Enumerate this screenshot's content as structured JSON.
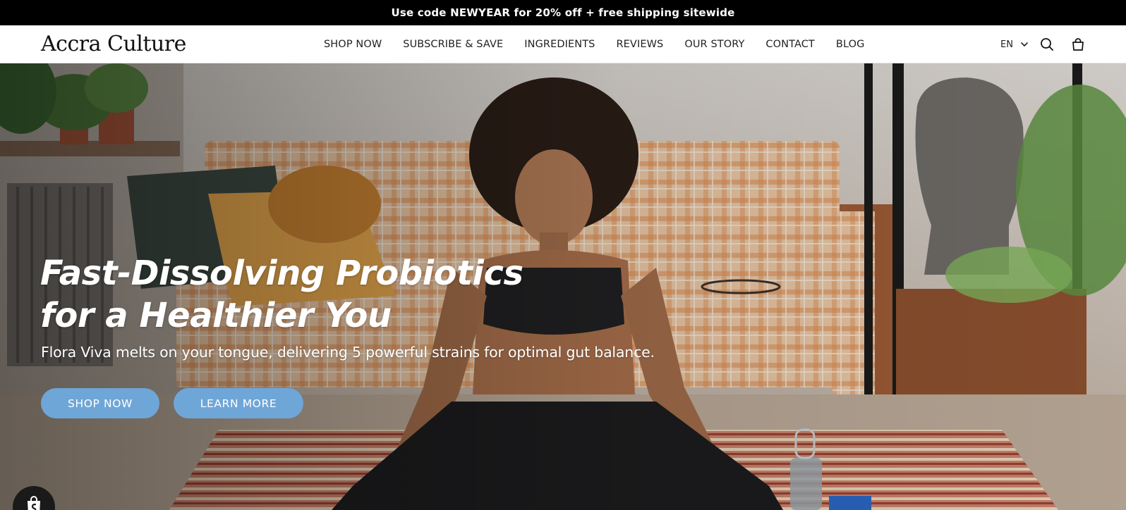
{
  "announcement": {
    "text": "Use code NEWYEAR for 20% off + free shipping sitewide"
  },
  "header": {
    "logo": "Accra Culture",
    "nav": [
      {
        "label": "SHOP NOW"
      },
      {
        "label": "SUBSCRIBE & SAVE"
      },
      {
        "label": "INGREDIENTS"
      },
      {
        "label": "REVIEWS"
      },
      {
        "label": "OUR STORY"
      },
      {
        "label": "CONTACT"
      },
      {
        "label": "BLOG"
      }
    ],
    "language": "EN",
    "icons": {
      "language_toggle": "chevron-down-icon",
      "search": "search-icon",
      "cart": "shopping-bag-icon"
    }
  },
  "hero": {
    "headline_line1": "Fast-Dissolving Probiotics",
    "headline_line2": "for a Healthier You",
    "subheadline": "Flora Viva melts on your tongue, delivering 5 powerful strains for optimal gut balance.",
    "primary_button": "SHOP NOW",
    "secondary_button": "LEARN MORE"
  },
  "colors": {
    "announcement_bg": "#000000",
    "button_bg": "#6fa6d8",
    "header_bg": "#ffffff"
  },
  "floating": {
    "icon": "shopify-bag-icon"
  }
}
